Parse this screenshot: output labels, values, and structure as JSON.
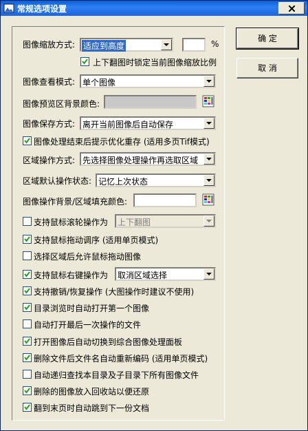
{
  "window": {
    "title": "常规选项设置",
    "icon": "app-icon"
  },
  "buttons": {
    "ok": "确 定",
    "cancel": "取 消"
  },
  "zoom": {
    "label": "图像缩放方式:",
    "value": "适应到高度",
    "percent_value": "",
    "percent_unit": "%"
  },
  "lock_zoom": {
    "label": "上下翻图时锁定当前图像缩放比例",
    "checked": true
  },
  "view_mode": {
    "label": "图像查看模式:",
    "value": "单个图像"
  },
  "preview_bg": {
    "label": "图像预览区背景颜色:",
    "color": "#c8c8c8",
    "picker_icon": "palette-icon"
  },
  "save_mode": {
    "label": "图像保存方式:",
    "value": "离开当前图像后自动保存"
  },
  "optimize_prompt": {
    "label": "图像处理结束后提示优化重存 (适用多页Tif模式)",
    "checked": true
  },
  "region_op": {
    "label": "区域操作方式:",
    "value": "先选择图像处理操作再选取区域"
  },
  "region_default": {
    "label": "区域默认操作状态:",
    "value": "记忆上次状态"
  },
  "fill_color": {
    "label": "图像操作背景/区域填充颜色:",
    "color": "#ffffff",
    "picker_icon": "palette-icon"
  },
  "wheel": {
    "label": "支持鼠标滚轮操作为",
    "checked": false,
    "value": "上下翻图"
  },
  "drag_order": {
    "label": "支持鼠标拖动调序 (适用单页模式)",
    "checked": true
  },
  "drag_after_select": {
    "label": "选择区域后允许鼠标拖动图像",
    "checked": false
  },
  "right_click": {
    "label": "支持鼠标右键操作为",
    "checked": true,
    "value": "取消区域选择"
  },
  "undo": {
    "label": "支持撤销/恢复操作 (大图操作时建议不使用)",
    "checked": true
  },
  "open_first": {
    "label": "目录浏览时自动打开第一个图像",
    "checked": true
  },
  "open_last": {
    "label": "自动打开最后一次操作的文件",
    "checked": false
  },
  "switch_panel": {
    "label": "打开图像后自动切换到综合图像处理面板",
    "checked": true
  },
  "renumber": {
    "label": "删除文件后文件名自动重新编码 (适用单页模式)",
    "checked": true
  },
  "recursive": {
    "label": "自动递归查找本目录及子目录下所有图像文件",
    "checked": false
  },
  "recycle": {
    "label": "删除的图像放入回收站以便还原",
    "checked": true
  },
  "next_doc": {
    "label": "翻到末页时自动跳到下一份文档",
    "checked": true
  }
}
